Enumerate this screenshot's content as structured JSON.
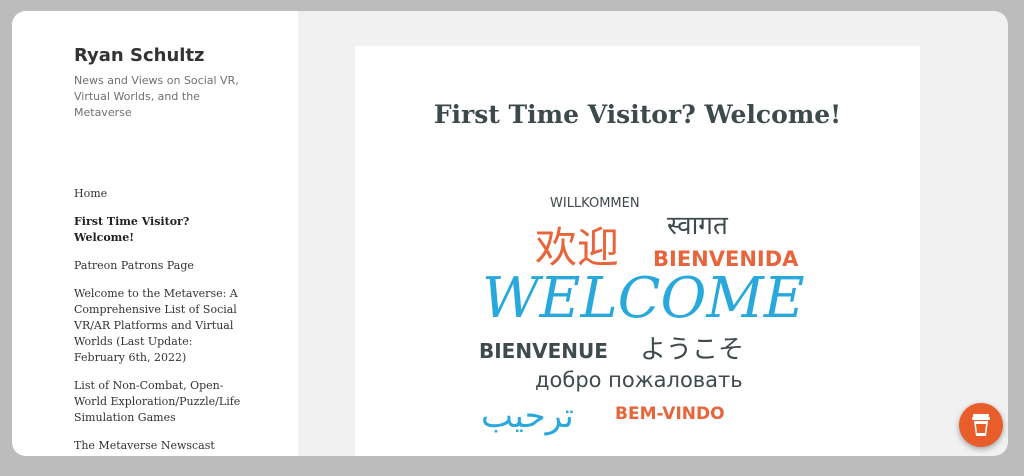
{
  "site": {
    "title": "Ryan Schultz",
    "description": "News and Views on Social VR, Virtual Worlds, and the Metaverse"
  },
  "nav": {
    "items": [
      {
        "label": "Home"
      },
      {
        "label": "First Time Visitor? Welcome!",
        "current": true
      },
      {
        "label": "Patreon Patrons Page"
      },
      {
        "label": "Welcome to the Metaverse: A Comprehensive List of Social VR/AR Platforms and Virtual Worlds (Last Update: February 6th, 2022)"
      },
      {
        "label": "List of Non-Combat, Open-World Exploration/Puzzle/Life Simulation Games"
      },
      {
        "label": "The Metaverse Newscast (Season One)"
      }
    ]
  },
  "page": {
    "title": "First Time Visitor? Welcome!"
  },
  "welcome_image": {
    "words": [
      "WILLKOMMEN",
      "स्वागत",
      "欢迎",
      "BIENVENIDA",
      "WELCOME",
      "BIENVENUE",
      "ようこそ",
      "добро пожаловать",
      "ترحيب",
      "BEM-VINDO"
    ],
    "colors": {
      "orange": "#e8643a",
      "blue": "#29a8dc",
      "dark": "#3e4a4c"
    }
  },
  "widget": {
    "icon": "coffee-cup-icon",
    "color": "#e85d2a"
  }
}
